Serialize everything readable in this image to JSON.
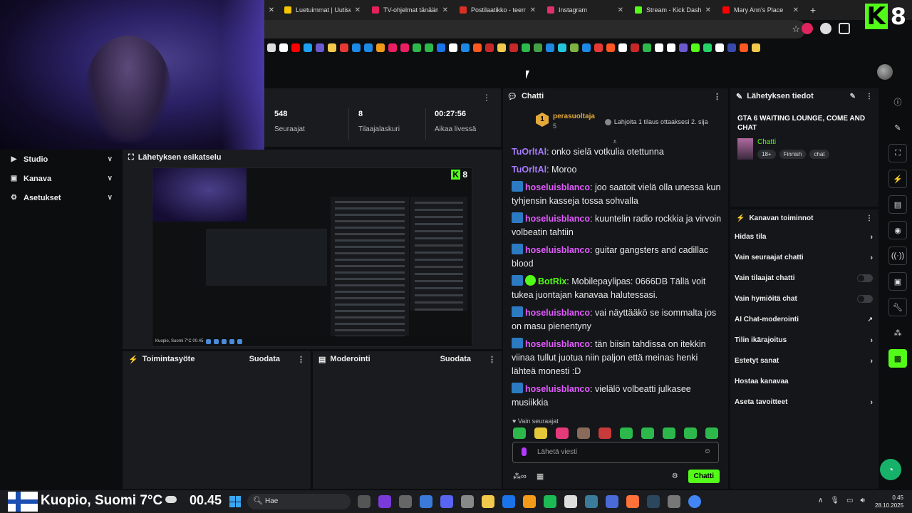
{
  "browser": {
    "tabs": [
      {
        "label": "Luetuimmat | Uutiset",
        "color": "#f5c400"
      },
      {
        "label": "TV-ohjelmat tänään | ",
        "color": "#e3225c"
      },
      {
        "label": "Postilaatikko - teemu",
        "color": "#d93025"
      },
      {
        "label": "Instagram",
        "color": "#e1306c"
      },
      {
        "label": "Stream - Kick Dashbo",
        "color": "#53fc18"
      },
      {
        "label": "Mary Ann's Place",
        "color": "#ff0000"
      }
    ],
    "new_tab": "+",
    "brand_number": "8"
  },
  "stats": {
    "followers_value": "548",
    "followers_label": "Seuraajat",
    "subs_value": "8",
    "subs_label": "Tilaajalaskuri",
    "time_value": "00:27:56",
    "time_label": "Aikaa livessä"
  },
  "sidebar": {
    "items": [
      {
        "label": "Studio"
      },
      {
        "label": "Kanava"
      },
      {
        "label": "Asetukset"
      }
    ]
  },
  "preview": {
    "title": "Lähetyksen esikatselu",
    "taskbar_text": "Kuopio, Suomi 7°C  00.45"
  },
  "activity": {
    "title": "Toimintasyöte",
    "filter": "Suodata"
  },
  "moderation": {
    "title": "Moderointi",
    "filter": "Suodata"
  },
  "chat": {
    "title": "Chatti",
    "pinned_rank": "1",
    "pinned_user": "perasuoltaja",
    "pinned_count": "5",
    "pinned_note": "Lahjoita 1 tilaus ottaaksesi 2. sija",
    "messages": [
      {
        "user": "TuOrltAl",
        "color": "#a97bff",
        "badge": "none",
        "text": "onko sielä votkulia otettunna"
      },
      {
        "user": "TuOrltAl",
        "color": "#a97bff",
        "badge": "none",
        "text": "Moroo"
      },
      {
        "user": "hoseluisblanco",
        "color": "#e25bff",
        "badge": "sub",
        "text": "joo saatoit vielä olla unessa kun tyhjensin kasseja tossa sohvalla"
      },
      {
        "user": "hoseluisblanco",
        "color": "#e25bff",
        "badge": "sub",
        "text": "kuuntelin radio rockkia ja virvoin volbeatin tahtiin"
      },
      {
        "user": "hoseluisblanco",
        "color": "#e25bff",
        "badge": "sub",
        "text": "guitar gangsters and cadillac blood"
      },
      {
        "user": "BotRix",
        "color": "#53fc18",
        "badge": "bot",
        "text": "Mobilepaylipas: 0666DB Tällä voit tukea juontajan kanavaa halutessasi."
      },
      {
        "user": "hoseluisblanco",
        "color": "#e25bff",
        "badge": "sub",
        "text": "vai näyttääkö se isommalta jos on masu pienentyny"
      },
      {
        "user": "hoseluisblanco",
        "color": "#e25bff",
        "badge": "sub",
        "text": "tän biisin tahdissa on itekkin viinaa tullut juotua niin paljon että meinas henki lähteä monesti :D"
      },
      {
        "user": "hoseluisblanco",
        "color": "#e25bff",
        "badge": "sub",
        "text": "vielälö volbeatti julkasee musiikkia"
      }
    ],
    "followers_only": "Vain seuraajat",
    "input_placeholder": "Lähetä viesti",
    "send_label": "Chatti"
  },
  "stream_info": {
    "title": "Lähetyksen tiedot",
    "stream_title": "GTA 6 WAITING LOUNGE, COME AND CHAT",
    "category": "Chatti",
    "tags": [
      "18+",
      "Finnish",
      "chat"
    ]
  },
  "channel_actions": {
    "title": "Kanavan toiminnot",
    "items": [
      {
        "label": "Hidas tila",
        "control": "chevron"
      },
      {
        "label": "Vain seuraajat chatti",
        "control": "chevron"
      },
      {
        "label": "Vain tilaajat chatti",
        "control": "toggle"
      },
      {
        "label": "Vain hymiöitä chat",
        "control": "toggle"
      },
      {
        "label": "AI Chat-moderointi",
        "control": "external"
      },
      {
        "label": "Tilin ikärajoitus",
        "control": "chevron"
      },
      {
        "label": "Estetyt sanat",
        "control": "chevron"
      },
      {
        "label": "Hostaa kanavaa",
        "control": "none"
      },
      {
        "label": "Aseta tavoitteet",
        "control": "chevron"
      }
    ]
  },
  "taskbar": {
    "weather": "Kuopio, Suomi 7°C",
    "clock_big": "00.45",
    "search_placeholder": "Hae",
    "time": "0.45",
    "date": "28.10.2025"
  },
  "colors": {
    "accent": "#53fc18",
    "panel": "#191b1f",
    "background": "#0b0d0f"
  }
}
